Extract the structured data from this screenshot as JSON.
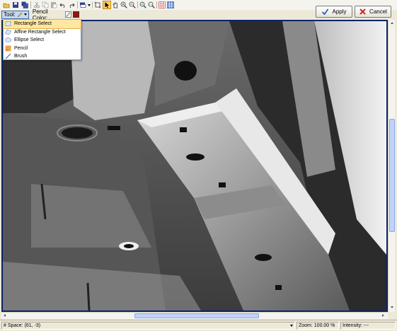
{
  "toolbar": {
    "icons": [
      "open-icon",
      "save-icon",
      "save-all-icon",
      "cut-icon",
      "copy-icon",
      "paste-icon",
      "undo-icon",
      "redo-icon",
      "layer-icon",
      "crop-icon",
      "pointer-icon",
      "hand-icon",
      "zoom-in-icon",
      "zoom-out-icon",
      "zoom-fit-in-icon",
      "zoom-fit-out-icon",
      "grid-icon",
      "grid-fill-icon"
    ]
  },
  "actions": {
    "apply_label": "Apply",
    "cancel_label": "Cancel"
  },
  "tool_bar": {
    "tool_label": "Tool:",
    "pencil_color_label": "Pencil Color:",
    "pencil_color": "#a01010"
  },
  "tool_menu": {
    "items": [
      {
        "label": "Rectangle Select",
        "icon": "rectangle-select-icon",
        "selected": true
      },
      {
        "label": "Affine Rectangle Select",
        "icon": "affine-rectangle-icon",
        "selected": false
      },
      {
        "label": "Ellipse Select",
        "icon": "ellipse-select-icon",
        "selected": false
      },
      {
        "label": "Pencil",
        "icon": "pencil-icon",
        "selected": false
      },
      {
        "label": "Brush",
        "icon": "brush-icon",
        "selected": false
      }
    ]
  },
  "status": {
    "space": "# Space: (61, -3)",
    "zoom": "Zoom: 100.00 %",
    "intensity": "Intensity: ---"
  }
}
